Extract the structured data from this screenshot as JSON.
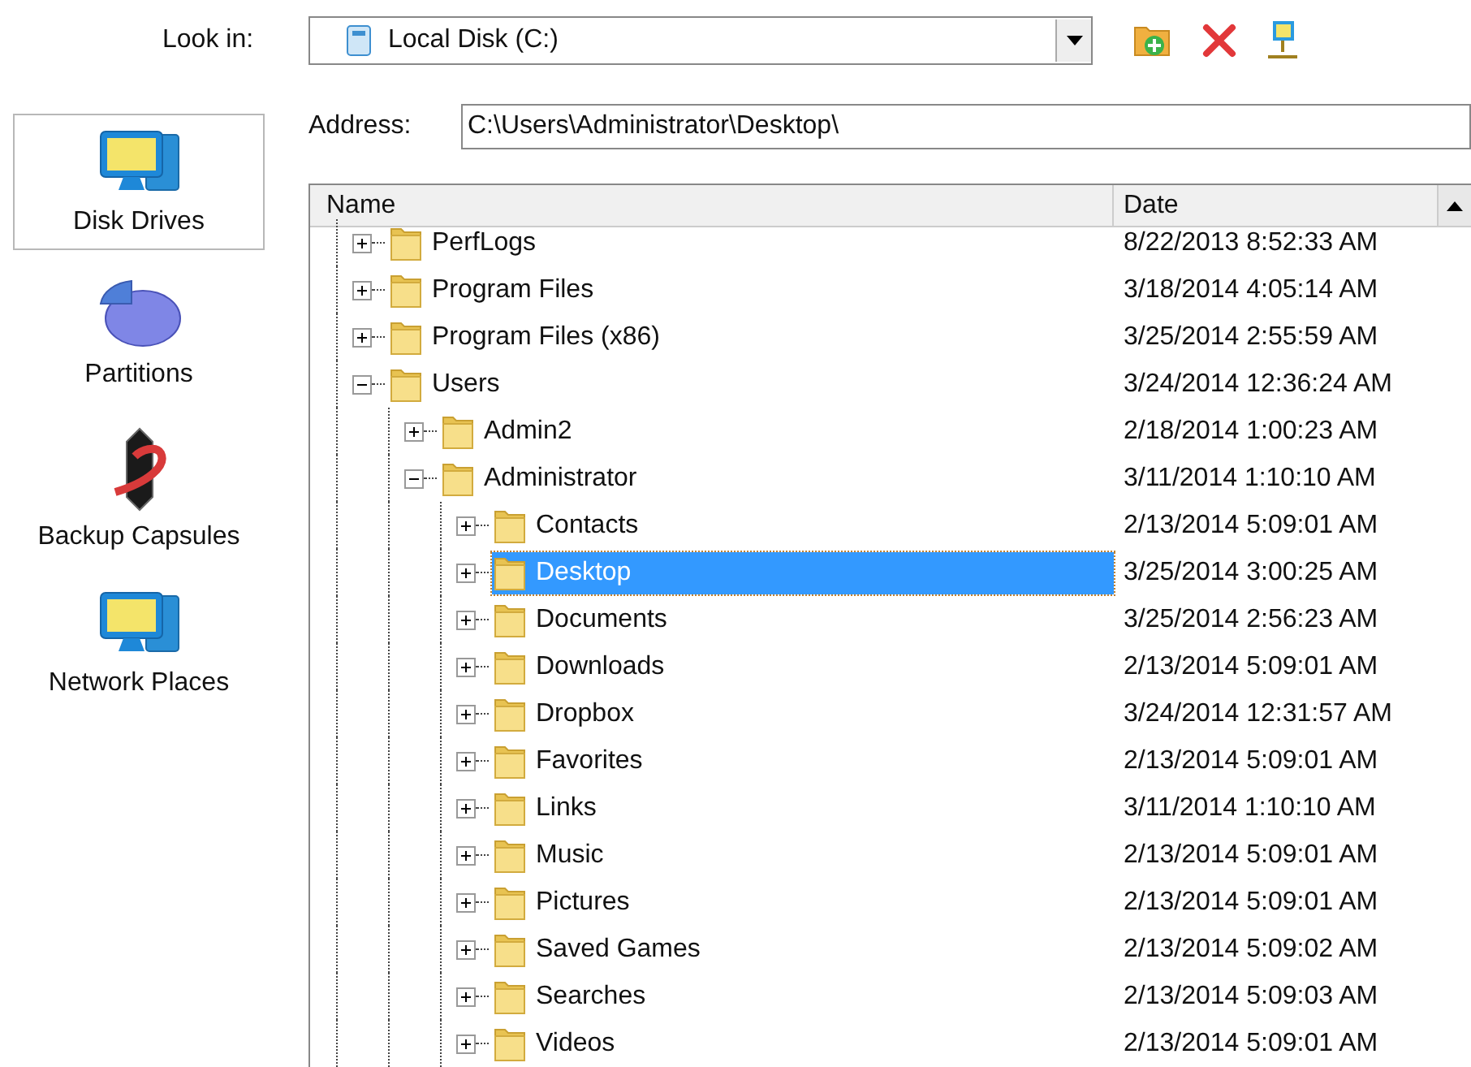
{
  "look_in": {
    "label": "Look in:",
    "value": "Local Disk (C:)"
  },
  "address": {
    "label": "Address:",
    "value": "C:\\Users\\Administrator\\Desktop\\"
  },
  "sidebar": {
    "items": [
      {
        "label": "Disk Drives",
        "kind": "drive",
        "selected": true
      },
      {
        "label": "Partitions",
        "kind": "partition",
        "selected": false
      },
      {
        "label": "Backup Capsules",
        "kind": "capsule",
        "selected": false
      },
      {
        "label": "Network Places",
        "kind": "network",
        "selected": false
      }
    ]
  },
  "tree": {
    "columns": [
      "Name",
      "Date"
    ],
    "rows": [
      {
        "name": "PerfLogs",
        "date": "8/22/2013 8:52:33 AM",
        "expanded": false,
        "selected": false
      },
      {
        "name": "Program Files",
        "date": "3/18/2014 4:05:14 AM",
        "expanded": false,
        "selected": false
      },
      {
        "name": "Program Files (x86)",
        "date": "3/25/2014 2:55:59 AM",
        "expanded": false,
        "selected": false
      },
      {
        "name": "Users",
        "date": "3/24/2014 12:36:24 AM",
        "expanded": true,
        "selected": false,
        "children": [
          {
            "name": "Admin2",
            "date": "2/18/2014 1:00:23 AM",
            "expanded": false,
            "selected": false
          },
          {
            "name": "Administrator",
            "date": "3/11/2014 1:10:10 AM",
            "expanded": true,
            "selected": false,
            "children": [
              {
                "name": "Contacts",
                "date": "2/13/2014 5:09:01 AM",
                "expanded": false,
                "selected": false
              },
              {
                "name": "Desktop",
                "date": "3/25/2014 3:00:25 AM",
                "expanded": false,
                "selected": true
              },
              {
                "name": "Documents",
                "date": "3/25/2014 2:56:23 AM",
                "expanded": false,
                "selected": false
              },
              {
                "name": "Downloads",
                "date": "2/13/2014 5:09:01 AM",
                "expanded": false,
                "selected": false
              },
              {
                "name": "Dropbox",
                "date": "3/24/2014 12:31:57 AM",
                "expanded": false,
                "selected": false
              },
              {
                "name": "Favorites",
                "date": "2/13/2014 5:09:01 AM",
                "expanded": false,
                "selected": false
              },
              {
                "name": "Links",
                "date": "3/11/2014 1:10:10 AM",
                "expanded": false,
                "selected": false
              },
              {
                "name": "Music",
                "date": "2/13/2014 5:09:01 AM",
                "expanded": false,
                "selected": false
              },
              {
                "name": "Pictures",
                "date": "2/13/2014 5:09:01 AM",
                "expanded": false,
                "selected": false
              },
              {
                "name": "Saved Games",
                "date": "2/13/2014 5:09:02 AM",
                "expanded": false,
                "selected": false
              },
              {
                "name": "Searches",
                "date": "2/13/2014 5:09:03 AM",
                "expanded": false,
                "selected": false
              },
              {
                "name": "Videos",
                "date": "2/13/2014 5:09:01 AM",
                "expanded": false,
                "selected": false
              }
            ]
          }
        ]
      }
    ]
  }
}
